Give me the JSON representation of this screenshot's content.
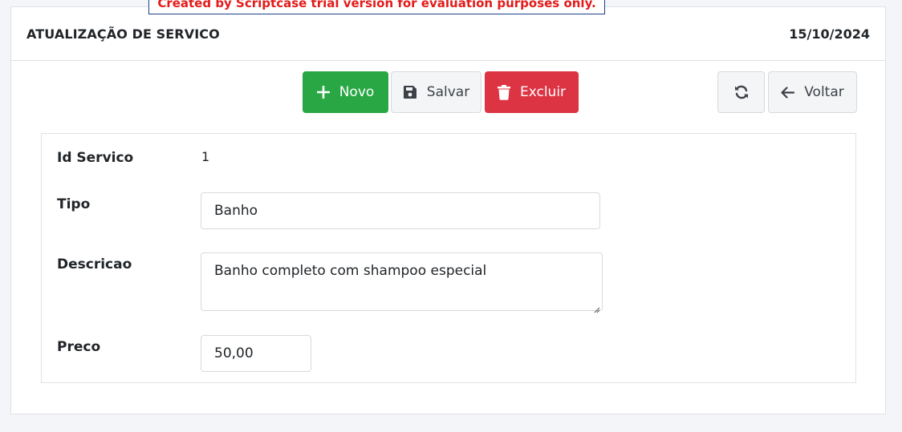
{
  "trial_notice": "Created by Scriptcase trial version for evaluation purposes only.",
  "header": {
    "title": "ATUALIZAÇÃO DE SERVICO",
    "date": "15/10/2024"
  },
  "toolbar": {
    "novo": {
      "label": "Novo",
      "icon": "plus-icon",
      "color": "#29a745"
    },
    "salvar": {
      "label": "Salvar",
      "icon": "floppy-disk-icon"
    },
    "excluir": {
      "label": "Excluir",
      "icon": "trash-icon",
      "color": "#dd3444"
    },
    "refresh": {
      "icon": "refresh-icon"
    },
    "voltar": {
      "label": "Voltar",
      "icon": "arrow-left-icon"
    }
  },
  "form": {
    "id_servico": {
      "label": "Id Servico",
      "value": "1"
    },
    "tipo": {
      "label": "Tipo",
      "value": "Banho"
    },
    "descricao": {
      "label": "Descricao",
      "value": "Banho completo com shampoo especial"
    },
    "preco": {
      "label": "Preco",
      "value": "50,00"
    }
  }
}
